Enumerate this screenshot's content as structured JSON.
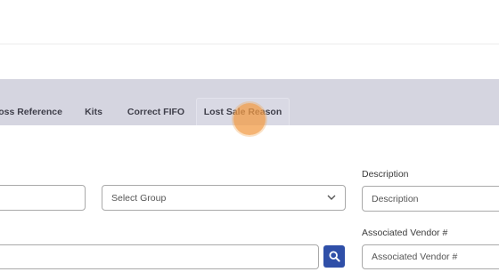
{
  "tabs": [
    {
      "label": "oss Reference"
    },
    {
      "label": "Kits"
    },
    {
      "label": "Correct FIFO"
    },
    {
      "label": "Lost Sale Reason"
    }
  ],
  "form": {
    "group_select": {
      "placeholder": "Select Group"
    },
    "description": {
      "label": "Description",
      "placeholder": "Description"
    },
    "associated_vendor": {
      "label": "Associated Vendor #",
      "placeholder": "Associated Vendor #"
    }
  },
  "icons": {
    "search": "search-icon",
    "dropdown": "chevron-down-icon"
  },
  "colors": {
    "tabbar_bg": "#d5d5e0",
    "search_button": "#2f4fa8",
    "click_indicator": "#f29b46"
  }
}
